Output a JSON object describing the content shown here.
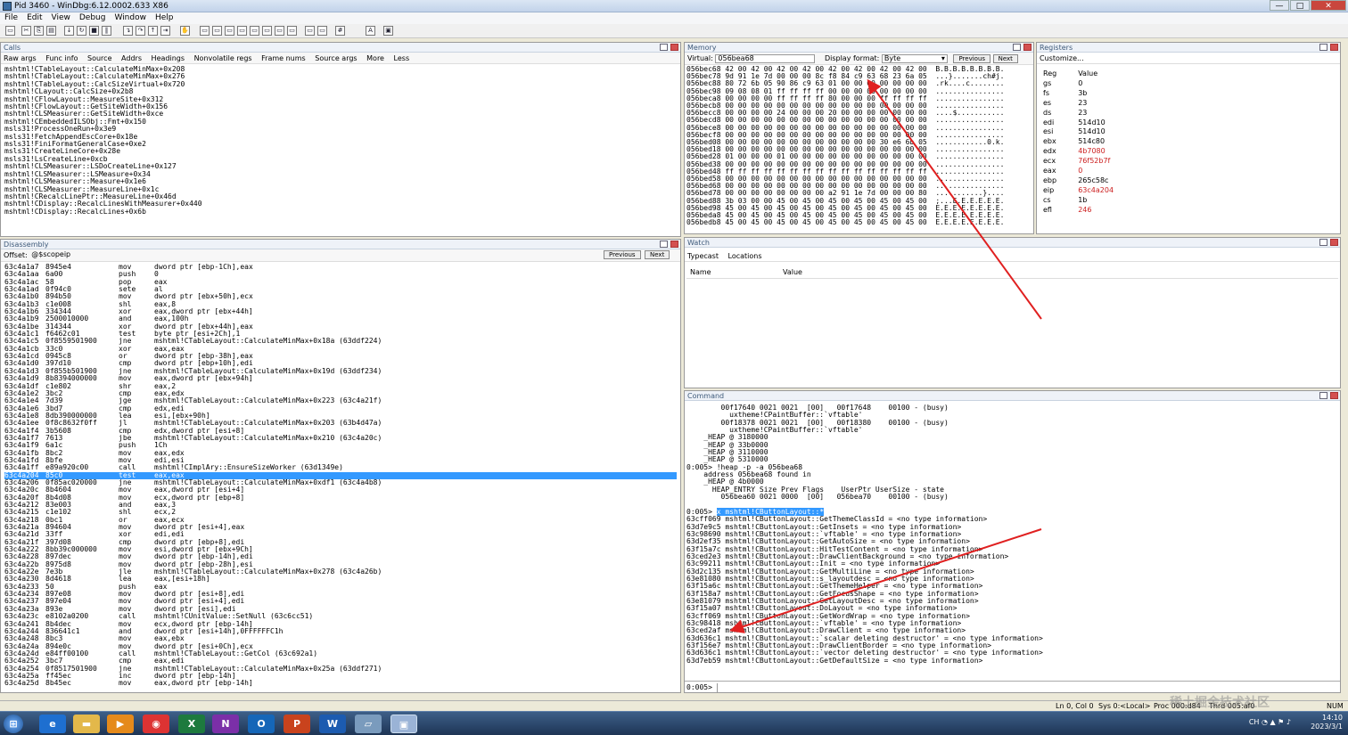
{
  "window": {
    "title": "Pid 3460 - WinDbg:6.12.0002.633 X86"
  },
  "menu": [
    "File",
    "Edit",
    "View",
    "Debug",
    "Window",
    "Help"
  ],
  "calls": {
    "title": "Calls",
    "options": [
      "Raw args",
      "Func info",
      "Source",
      "Addrs",
      "Headings",
      "Nonvolatile regs",
      "Frame nums",
      "Source args",
      "More",
      "Less"
    ],
    "lines": [
      "mshtml!CTableLayout::CalculateMinMax+0x208",
      "mshtml!CTableLayout::CalculateMinMax+0x276",
      "mshtml!CTableLayout::CalcSizeVirtual+0x720",
      "mshtml!CLayout::CalcSize+0x2b8",
      "mshtml!CFlowLayout::MeasureSite+0x312",
      "mshtml!CFlowLayout::GetSiteWidth+0x156",
      "mshtml!CLSMeasurer::GetSiteWidth+0xce",
      "mshtml!CEmbeddedILSObj::Fmt+0x150",
      "msls31!ProcessOneRun+0x3e9",
      "msls31!FetchAppendEscCore+0x18e",
      "msls31!FiniFormatGeneralCase+0xe2",
      "msls31!CreateLineCore+0x28e",
      "msls31!LsCreateLine+0xcb",
      "mshtml!CLSMeasurer::LSDoCreateLine+0x127",
      "mshtml!CLSMeasurer::LSMeasure+0x34",
      "mshtml!CLSMeasurer::Measure+0x1e6",
      "mshtml!CLSMeasurer::MeasureLine+0x1c",
      "mshtml!CRecalcLinePtr::MeasureLine+0x46d",
      "mshtml!CDisplay::RecalcLinesWithMeasurer+0x440",
      "mshtml!CDisplay::RecalcLines+0x6b"
    ]
  },
  "memory": {
    "title": "Memory",
    "virtual_label": "Virtual:",
    "virtual_value": "056bea68",
    "format_label": "Display format:",
    "format_value": "Byte",
    "previous": "Previous",
    "next": "Next",
    "lines": [
      "056bec68 42 00 42 00 42 00 42 00 42 00 42 00 42 00 42 00  B.B.B.B.B.B.B.B.",
      "056bec78 9d 91 1e 7d 00 00 00 8c f8 84 c9 63 68 23 6a 05  ...}.......ch#j.",
      "056bec88 80 72 6b 05 90 86 c9 63 01 00 00 00 00 00 00 00  .rk....c........",
      "056bec98 09 08 08 01 ff ff ff ff 00 00 00 00 00 00 00 00  ................",
      "056beca8 00 00 00 00 ff ff ff ff 80 00 00 00 ff ff ff ff  ................",
      "056becb8 00 00 00 00 00 00 00 00 00 00 00 00 00 00 00 00  ................",
      "056becc8 00 00 00 00 24 00 00 00 20 00 00 00 00 00 00 00  ....$...........",
      "056becd8 00 00 00 00 00 00 00 00 00 00 00 00 00 00 00 00  ................",
      "056bece8 00 00 00 00 00 00 00 00 00 00 00 00 00 00 00 00  ................",
      "056becf8 00 00 00 00 00 00 00 00 00 00 00 00 00 00 00 00  ................",
      "056bed08 00 00 00 00 00 00 00 00 00 00 00 00 30 e6 6b 05  ............0.k.",
      "056bed18 00 00 00 00 00 00 00 00 00 00 00 00 00 00 00 00  ................",
      "056bed28 01 00 00 00 01 00 00 00 00 00 00 00 00 00 00 00  ................",
      "056bed38 00 00 00 00 00 00 00 00 00 00 00 00 00 00 00 00  ................",
      "056bed48 ff ff ff ff ff ff ff ff ff ff ff ff ff ff ff ff  ................",
      "056bed58 00 00 00 00 00 00 00 00 00 00 00 00 00 00 00 00  ................",
      "056bed68 00 00 00 00 00 00 00 00 00 00 00 00 00 00 00 00  ................",
      "056bed78 00 00 00 00 00 00 00 00 a2 91 1e 7d 00 00 00 80  ...........}....",
      "056bed88 3b 03 00 00 45 00 45 00 45 00 45 00 45 00 45 00  ;...E.E.E.E.E.E.",
      "056bed98 45 00 45 00 45 00 45 00 45 00 45 00 45 00 45 00  E.E.E.E.E.E.E.E.",
      "056beda8 45 00 45 00 45 00 45 00 45 00 45 00 45 00 45 00  E.E.E.E.E.E.E.E.",
      "056bedb8 45 00 45 00 45 00 45 00 45 00 45 00 45 00 45 00  E.E.E.E.E.E.E.E."
    ]
  },
  "registers": {
    "title": "Registers",
    "customize": "Customize...",
    "col_reg": "Reg",
    "col_value": "Value",
    "rows": [
      {
        "reg": "gs",
        "val": "0",
        "changed": false
      },
      {
        "reg": "fs",
        "val": "3b",
        "changed": false
      },
      {
        "reg": "es",
        "val": "23",
        "changed": false
      },
      {
        "reg": "ds",
        "val": "23",
        "changed": false
      },
      {
        "reg": "edi",
        "val": "514d10",
        "changed": false
      },
      {
        "reg": "esi",
        "val": "514d10",
        "changed": false
      },
      {
        "reg": "ebx",
        "val": "514c80",
        "changed": false
      },
      {
        "reg": "edx",
        "val": "4b7080",
        "changed": true
      },
      {
        "reg": "ecx",
        "val": "76f52b7f",
        "changed": true
      },
      {
        "reg": "eax",
        "val": "0",
        "changed": true
      },
      {
        "reg": "ebp",
        "val": "265c58c",
        "changed": false
      },
      {
        "reg": "eip",
        "val": "63c4a204",
        "changed": true
      },
      {
        "reg": "cs",
        "val": "1b",
        "changed": false
      },
      {
        "reg": "efl",
        "val": "246",
        "changed": true
      }
    ]
  },
  "disassembly": {
    "title": "Disassembly",
    "offset_label": "Offset:",
    "offset_value": "@$scopeip",
    "previous": "Previous",
    "next": "Next",
    "highlight_index": 28,
    "lines": [
      [
        "63c4a1a7",
        "8945e4",
        "mov",
        "dword ptr [ebp-1Ch],eax"
      ],
      [
        "63c4a1aa",
        "6a00",
        "push",
        "0"
      ],
      [
        "63c4a1ac",
        "58",
        "pop",
        "eax"
      ],
      [
        "63c4a1ad",
        "0f94c0",
        "sete",
        "al"
      ],
      [
        "63c4a1b0",
        "894b50",
        "mov",
        "dword ptr [ebx+50h],ecx"
      ],
      [
        "63c4a1b3",
        "c1e008",
        "shl",
        "eax,8"
      ],
      [
        "63c4a1b6",
        "334344",
        "xor",
        "eax,dword ptr [ebx+44h]"
      ],
      [
        "63c4a1b9",
        "2500010000",
        "and",
        "eax,100h"
      ],
      [
        "63c4a1be",
        "314344",
        "xor",
        "dword ptr [ebx+44h],eax"
      ],
      [
        "63c4a1c1",
        "f6462c01",
        "test",
        "byte ptr [esi+2Ch],1"
      ],
      [
        "63c4a1c5",
        "0f8559501900",
        "jne",
        "mshtml!CTableLayout::CalculateMinMax+0x18a (63ddf224)"
      ],
      [
        "63c4a1cb",
        "33c0",
        "xor",
        "eax,eax"
      ],
      [
        "63c4a1cd",
        "0945c8",
        "or",
        "dword ptr [ebp-38h],eax"
      ],
      [
        "63c4a1d0",
        "397d10",
        "cmp",
        "dword ptr [ebp+10h],edi"
      ],
      [
        "63c4a1d3",
        "0f855b501900",
        "jne",
        "mshtml!CTableLayout::CalculateMinMax+0x19d (63ddf234)"
      ],
      [
        "63c4a1d9",
        "8b8394000000",
        "mov",
        "eax,dword ptr [ebx+94h]"
      ],
      [
        "63c4a1df",
        "c1e802",
        "shr",
        "eax,2"
      ],
      [
        "63c4a1e2",
        "3bc2",
        "cmp",
        "eax,edx"
      ],
      [
        "63c4a1e4",
        "7d39",
        "jge",
        "mshtml!CTableLayout::CalculateMinMax+0x223 (63c4a21f)"
      ],
      [
        "63c4a1e6",
        "3bd7",
        "cmp",
        "edx,edi"
      ],
      [
        "63c4a1e8",
        "8db390000000",
        "lea",
        "esi,[ebx+90h]"
      ],
      [
        "63c4a1ee",
        "0f8c8632f0ff",
        "jl",
        "mshtml!CTableLayout::CalculateMinMax+0x203 (63b4d47a)"
      ],
      [
        "63c4a1f4",
        "3b5608",
        "cmp",
        "edx,dword ptr [esi+8]"
      ],
      [
        "63c4a1f7",
        "7613",
        "jbe",
        "mshtml!CTableLayout::CalculateMinMax+0x210 (63c4a20c)"
      ],
      [
        "63c4a1f9",
        "6a1c",
        "push",
        "1Ch"
      ],
      [
        "63c4a1fb",
        "8bc2",
        "mov",
        "eax,edx"
      ],
      [
        "63c4a1fd",
        "8bfe",
        "mov",
        "edi,esi"
      ],
      [
        "63c4a1ff",
        "e89a920c00",
        "call",
        "mshtml!CImplAry::EnsureSizeWorker (63d1349e)"
      ],
      [
        "63c4a204",
        "85c0",
        "test",
        "eax,eax"
      ],
      [
        "63c4a206",
        "0f85ac020000",
        "jne",
        "mshtml!CTableLayout::CalculateMinMax+0xdf1 (63c4a4b8)"
      ],
      [
        "63c4a20c",
        "8b4604",
        "mov",
        "eax,dword ptr [esi+4]"
      ],
      [
        "63c4a20f",
        "8b4d08",
        "mov",
        "ecx,dword ptr [ebp+8]"
      ],
      [
        "63c4a212",
        "83e003",
        "and",
        "eax,3"
      ],
      [
        "63c4a215",
        "c1e102",
        "shl",
        "ecx,2"
      ],
      [
        "63c4a218",
        "0bc1",
        "or",
        "eax,ecx"
      ],
      [
        "63c4a21a",
        "894604",
        "mov",
        "dword ptr [esi+4],eax"
      ],
      [
        "63c4a21d",
        "33ff",
        "xor",
        "edi,edi"
      ],
      [
        "63c4a21f",
        "397d08",
        "cmp",
        "dword ptr [ebp+8],edi"
      ],
      [
        "63c4a222",
        "8bb39c000000",
        "mov",
        "esi,dword ptr [ebx+9Ch]"
      ],
      [
        "63c4a228",
        "897dec",
        "mov",
        "dword ptr [ebp-14h],edi"
      ],
      [
        "63c4a22b",
        "8975d8",
        "mov",
        "dword ptr [ebp-28h],esi"
      ],
      [
        "63c4a22e",
        "7e3b",
        "jle",
        "mshtml!CTableLayout::CalculateMinMax+0x278 (63c4a26b)"
      ],
      [
        "63c4a230",
        "8d4618",
        "lea",
        "eax,[esi+18h]"
      ],
      [
        "63c4a233",
        "50",
        "push",
        "eax"
      ],
      [
        "63c4a234",
        "897e08",
        "mov",
        "dword ptr [esi+8],edi"
      ],
      [
        "63c4a237",
        "897e04",
        "mov",
        "dword ptr [esi+4],edi"
      ],
      [
        "63c4a23a",
        "893e",
        "mov",
        "dword ptr [esi],edi"
      ],
      [
        "63c4a23c",
        "e8102a0200",
        "call",
        "mshtml!CUnitValue::SetNull (63c6cc51)"
      ],
      [
        "63c4a241",
        "8b4dec",
        "mov",
        "ecx,dword ptr [ebp-14h]"
      ],
      [
        "63c4a244",
        "836641c1",
        "and",
        "dword ptr [esi+14h],0FFFFFFC1h"
      ],
      [
        "63c4a248",
        "8bc3",
        "mov",
        "eax,ebx"
      ],
      [
        "63c4a24a",
        "894e0c",
        "mov",
        "dword ptr [esi+0Ch],ecx"
      ],
      [
        "63c4a24d",
        "e84ff00100",
        "call",
        "mshtml!CTableLayout::GetCol (63c692a1)"
      ],
      [
        "63c4a252",
        "3bc7",
        "cmp",
        "eax,edi"
      ],
      [
        "63c4a254",
        "0f8517501900",
        "jne",
        "mshtml!CTableLayout::CalculateMinMax+0x25a (63ddf271)"
      ],
      [
        "63c4a25a",
        "ff45ec",
        "inc",
        "dword ptr [ebp-14h]"
      ],
      [
        "63c4a25d",
        "8b45ec",
        "mov",
        "eax,dword ptr [ebp-14h]"
      ]
    ]
  },
  "watch": {
    "title": "Watch",
    "tabs": [
      "Typecast",
      "Locations"
    ],
    "col_name": "Name",
    "col_value": "Value"
  },
  "command": {
    "title": "Command",
    "prompt": "0:005>",
    "highlight_index": 14,
    "lines": [
      "        00f17640 0021 0021  [00]   00f17648    00100 - (busy)",
      "          uxtheme!CPaintBuffer::`vftable'",
      "        00f18378 0021 0021  [00]   00f18380    00100 - (busy)",
      "          uxtheme!CPaintBuffer::`vftable'",
      "    _HEAP @ 3180000",
      "    _HEAP @ 33b0000",
      "    _HEAP @ 3110000",
      "    _HEAP @ 5310000",
      "0:005> !heap -p -a 056bea68",
      "    address 056bea68 found in",
      "    _HEAP @ 4b0000",
      "      HEAP_ENTRY Size Prev Flags    UserPtr UserSize - state",
      "        056bea60 0021 0000  [00]   056bea70    00100 - (busy)",
      "",
      "0:005> x mshtml!CButtonLayout::*",
      "63cff069 mshtml!CButtonLayout::GetThemeClassId = <no type information>",
      "63d7e9c5 mshtml!CButtonLayout::GetInsets = <no type information>",
      "63c98690 mshtml!CButtonLayout::`vftable' = <no type information>",
      "63d2ef35 mshtml!CButtonLayout::GetAutoSize = <no type information>",
      "63f15a7c mshtml!CButtonLayout::HitTestContent = <no type information>",
      "63ced2e3 mshtml!CButtonLayout::DrawClientBackground = <no type information>",
      "63c99211 mshtml!CButtonLayout::Init = <no type information>",
      "63d2c135 mshtml!CButtonLayout::GetMultiLine = <no type information>",
      "63e81080 mshtml!CButtonLayout::s_layoutdesc = <no type information>",
      "63f15a6c mshtml!CButtonLayout::GetThemeHelper = <no type information>",
      "63f158a7 mshtml!CButtonLayout::GetFocusShape = <no type information>",
      "63e81079 mshtml!CButtonLayout::GetLayoutDesc = <no type information>",
      "63f15a07 mshtml!CButtonLayout::DoLayout = <no type information>",
      "63cff069 mshtml!CButtonLayout::GetWordWrap = <no type information>",
      "63c98418 mshtml!CButtonLayout::`vftable' = <no type information>",
      "63ced2af mshtml!CButtonLayout::DrawClient = <no type information>",
      "63d636c1 mshtml!CButtonLayout::`scalar deleting destructor' = <no type information>",
      "63f156e7 mshtml!CButtonLayout::DrawClientBorder = <no type information>",
      "63d636c1 mshtml!CButtonLayout::`vector deleting destructor' = <no type information>",
      "63d7eb59 mshtml!CButtonLayout::GetDefaultSize = <no type information>"
    ]
  },
  "status": {
    "lncol": "Ln 0, Col 0",
    "sys": "Sys 0:<Local>",
    "proc": "Proc 000:d84",
    "thrd": "Thrd 005:af0",
    "num": "NUM"
  },
  "taskbar": {
    "time": "14:10",
    "date": "2023/3/1"
  },
  "watermark": "稀土掘金技术社区",
  "colors": {
    "annotation_arrow": "#e02020",
    "selection": "#3399ff",
    "changed_register": "#cc2020"
  }
}
